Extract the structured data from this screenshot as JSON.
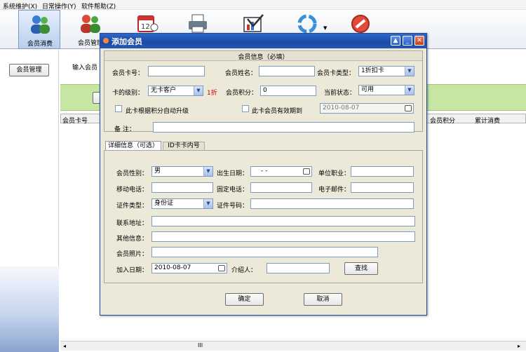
{
  "menu": [
    "系统维护(X)",
    "日常操作(Y)",
    "软件帮助(Z)"
  ],
  "toolbar": {
    "items": [
      {
        "label": "会员消费",
        "icon": "members-icon"
      },
      {
        "label": "会员管理",
        "icon": "member-management-icon"
      },
      {
        "label": "",
        "icon": "calendar-icon"
      },
      {
        "label": "",
        "icon": "printer-icon"
      },
      {
        "label": "",
        "icon": "chart-check-icon"
      },
      {
        "label": "",
        "icon": "recycle-icon"
      },
      {
        "label": "",
        "icon": "stop-icon"
      }
    ]
  },
  "left_panel": {
    "button": "会员管理"
  },
  "background": {
    "input_prompt": "输入会员",
    "grid_headers": [
      "会员卡号",
      "会员积分",
      "累计消费"
    ]
  },
  "dialog": {
    "title": "添加会员",
    "required_section": "会员信息（必填）",
    "fields": {
      "card_no_label": "会员卡号：",
      "card_no_value": "",
      "name_label": "会员姓名：",
      "name_value": "",
      "card_type_label": "会员卡类型：",
      "card_type_value": "1折扣卡",
      "level_label": "卡的级别：",
      "level_value": "无卡客户",
      "level_discount": "1折",
      "points_label": "会员积分：",
      "points_value": "0",
      "status_label": "当前状态：",
      "status_value": "可用",
      "auto_upgrade_label": "此卡根据积分自动升级",
      "expiry_label": "此卡会员有效期到",
      "expiry_value": "2010-08-07",
      "remarks_label": "备    注："
    },
    "tabs": [
      "详细信息（可选）",
      "ID卡卡内号"
    ],
    "detail": {
      "gender_label": "会员性别：",
      "gender_value": "男",
      "birth_label": "出生日期：",
      "birth_value": "- -",
      "job_label": "单位职业：",
      "mobile_label": "移动电话：",
      "phone_label": "固定电话：",
      "email_label": "电子邮件：",
      "id_type_label": "证件类型：",
      "id_type_value": "身份证",
      "id_no_label": "证件号码：",
      "address_label": "联系地址：",
      "other_label": "其他信息：",
      "photo_label": "会员照片：",
      "join_date_label": "加入日期：",
      "join_date_value": "2010-08-07",
      "referrer_label": "介绍人：",
      "search_button": "查找"
    },
    "ok_button": "确定",
    "cancel_button": "取消"
  },
  "scrollbar_grip": "III",
  "colors": {
    "title_bar": "#1a4aa3",
    "accent_red": "#cc0000",
    "green_band": "#c7e6a4"
  }
}
